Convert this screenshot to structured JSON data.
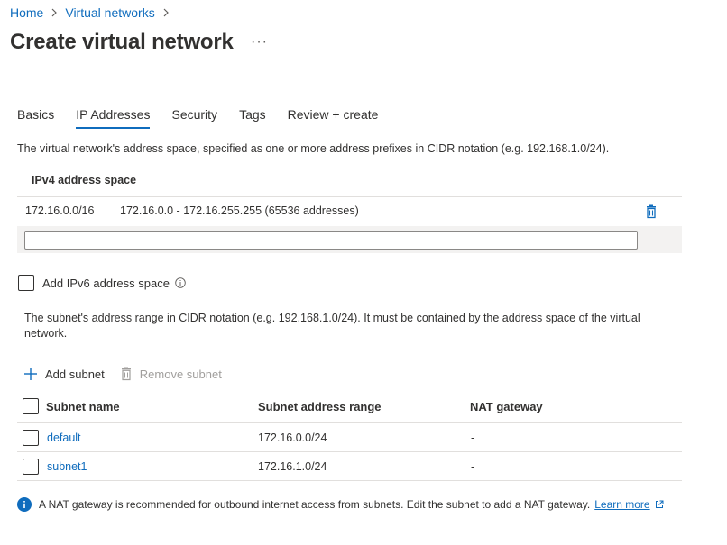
{
  "breadcrumb": {
    "home": "Home",
    "parent": "Virtual networks"
  },
  "page": {
    "title": "Create virtual network",
    "more": "···"
  },
  "tabs": [
    {
      "label": "Basics"
    },
    {
      "label": "IP Addresses"
    },
    {
      "label": "Security"
    },
    {
      "label": "Tags"
    },
    {
      "label": "Review + create"
    }
  ],
  "active_tab": "IP Addresses",
  "address_space": {
    "description": "The virtual network's address space, specified as one or more address prefixes in CIDR notation (e.g. 192.168.1.0/24).",
    "column_header": "IPv4 address space",
    "rows": [
      {
        "prefix": "172.16.0.0/16",
        "range": "172.16.0.0 - 172.16.255.255 (65536 addresses)"
      }
    ],
    "new_value": ""
  },
  "ipv6": {
    "label": "Add IPv6 address space",
    "checked": false,
    "info_icon": "info-icon"
  },
  "subnets": {
    "description": "The subnet's address range in CIDR notation (e.g. 192.168.1.0/24). It must be contained by the address space of the virtual network.",
    "add_label": "Add subnet",
    "remove_label": "Remove subnet",
    "columns": {
      "name": "Subnet name",
      "range": "Subnet address range",
      "nat": "NAT gateway"
    },
    "rows": [
      {
        "name": "default",
        "range": "172.16.0.0/24",
        "nat": "-"
      },
      {
        "name": "subnet1",
        "range": "172.16.1.0/24",
        "nat": "-"
      }
    ]
  },
  "note": {
    "text": "A NAT gateway is recommended for outbound internet access from subnets. Edit the subnet to add a NAT gateway.",
    "link": "Learn more"
  },
  "colors": {
    "accent": "#0f6cbd",
    "band": "#f3f2f1",
    "text": "#323130",
    "disabled": "#a19f9d"
  }
}
